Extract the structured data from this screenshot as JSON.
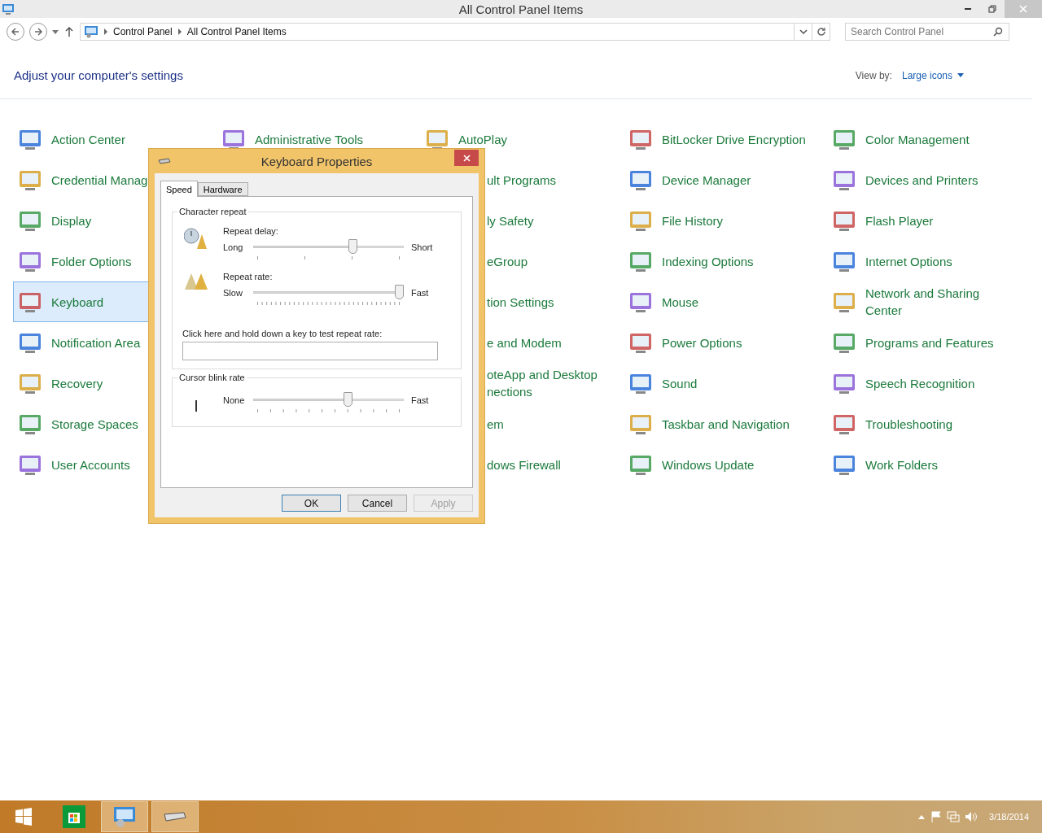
{
  "window": {
    "title": "All Control Panel Items"
  },
  "address": {
    "crumbs": [
      "Control Panel",
      "All Control Panel Items"
    ]
  },
  "search": {
    "placeholder": "Search Control Panel"
  },
  "header": {
    "title": "Adjust your computer's settings",
    "view_by_label": "View by:",
    "view_by_value": "Large icons"
  },
  "columns": [
    [
      {
        "kind": "full",
        "lines": [
          "Action Center"
        ],
        "selected": false
      },
      {
        "kind": "full",
        "lines": [
          "Credential Manag"
        ],
        "selected": false
      },
      {
        "kind": "full",
        "lines": [
          "Display"
        ],
        "selected": false
      },
      {
        "kind": "full",
        "lines": [
          "Folder Options"
        ],
        "selected": false
      },
      {
        "kind": "full",
        "lines": [
          "Keyboard"
        ],
        "selected": true
      },
      {
        "kind": "full",
        "lines": [
          "Notification Area"
        ],
        "selected": false
      },
      {
        "kind": "full",
        "lines": [
          "Recovery"
        ],
        "selected": false
      },
      {
        "kind": "full",
        "lines": [
          "Storage Spaces"
        ],
        "selected": false
      },
      {
        "kind": "full",
        "lines": [
          "User Accounts"
        ],
        "selected": false
      }
    ],
    [
      {
        "kind": "full",
        "lines": [
          "Administrative Tools"
        ],
        "selected": false
      }
    ],
    [
      {
        "kind": "full",
        "lines": [
          "AutoPlay"
        ],
        "selected": false
      },
      {
        "kind": "partial",
        "lines": [
          "ult Programs"
        ],
        "selected": false
      },
      {
        "kind": "partial",
        "lines": [
          "ly Safety"
        ],
        "selected": false
      },
      {
        "kind": "partial",
        "lines": [
          "eGroup"
        ],
        "selected": false
      },
      {
        "kind": "partial",
        "lines": [
          "tion Settings"
        ],
        "selected": false
      },
      {
        "kind": "partial",
        "lines": [
          "e and Modem"
        ],
        "selected": false
      },
      {
        "kind": "partial",
        "lines": [
          "oteApp and Desktop",
          "nections"
        ],
        "selected": false
      },
      {
        "kind": "partial",
        "lines": [
          "em"
        ],
        "selected": false
      },
      {
        "kind": "partial",
        "lines": [
          "dows Firewall"
        ],
        "selected": false
      }
    ],
    [
      {
        "kind": "full",
        "lines": [
          "BitLocker Drive Encryption"
        ],
        "selected": false
      },
      {
        "kind": "full",
        "lines": [
          "Device Manager"
        ],
        "selected": false
      },
      {
        "kind": "full",
        "lines": [
          "File History"
        ],
        "selected": false
      },
      {
        "kind": "full",
        "lines": [
          "Indexing Options"
        ],
        "selected": false
      },
      {
        "kind": "full",
        "lines": [
          "Mouse"
        ],
        "selected": false
      },
      {
        "kind": "full",
        "lines": [
          "Power Options"
        ],
        "selected": false
      },
      {
        "kind": "full",
        "lines": [
          "Sound"
        ],
        "selected": false
      },
      {
        "kind": "full",
        "lines": [
          "Taskbar and Navigation"
        ],
        "selected": false
      },
      {
        "kind": "full",
        "lines": [
          "Windows Update"
        ],
        "selected": false
      }
    ],
    [
      {
        "kind": "full",
        "lines": [
          "Color Management"
        ],
        "selected": false
      },
      {
        "kind": "full",
        "lines": [
          "Devices and Printers"
        ],
        "selected": false
      },
      {
        "kind": "full",
        "lines": [
          "Flash Player"
        ],
        "selected": false
      },
      {
        "kind": "full",
        "lines": [
          "Internet Options"
        ],
        "selected": false
      },
      {
        "kind": "full",
        "lines": [
          "Network and Sharing",
          "Center"
        ],
        "selected": false
      },
      {
        "kind": "full",
        "lines": [
          "Programs and Features"
        ],
        "selected": false
      },
      {
        "kind": "full",
        "lines": [
          "Speech Recognition"
        ],
        "selected": false
      },
      {
        "kind": "full",
        "lines": [
          "Troubleshooting"
        ],
        "selected": false
      },
      {
        "kind": "full",
        "lines": [
          "Work Folders"
        ],
        "selected": false
      }
    ]
  ],
  "dialog": {
    "title": "Keyboard Properties",
    "tabs": [
      {
        "label": "Speed",
        "selected": true
      },
      {
        "label": "Hardware",
        "selected": false
      }
    ],
    "groups": [
      {
        "legend": "Character repeat",
        "sliders": [
          {
            "kind": "delay",
            "label": "Repeat delay:",
            "min_label": "Long",
            "max_label": "Short",
            "level": 0.67
          },
          {
            "kind": "rate",
            "label": "Repeat rate:",
            "min_label": "Slow",
            "max_label": "Fast",
            "level": 1
          }
        ],
        "test_label": "Click here and hold down a key to test repeat rate:"
      },
      {
        "legend": "Cursor blink rate",
        "sliders": [
          {
            "kind": "blink",
            "min_label": "None",
            "max_label": "Fast",
            "level": 0.64
          }
        ]
      }
    ],
    "buttons": [
      {
        "label": "OK",
        "default": true,
        "disabled": false
      },
      {
        "label": "Cancel",
        "default": false,
        "disabled": false
      },
      {
        "label": "Apply",
        "default": false,
        "disabled": true
      }
    ]
  },
  "taskbar": {
    "date": "3/18/2014"
  }
}
